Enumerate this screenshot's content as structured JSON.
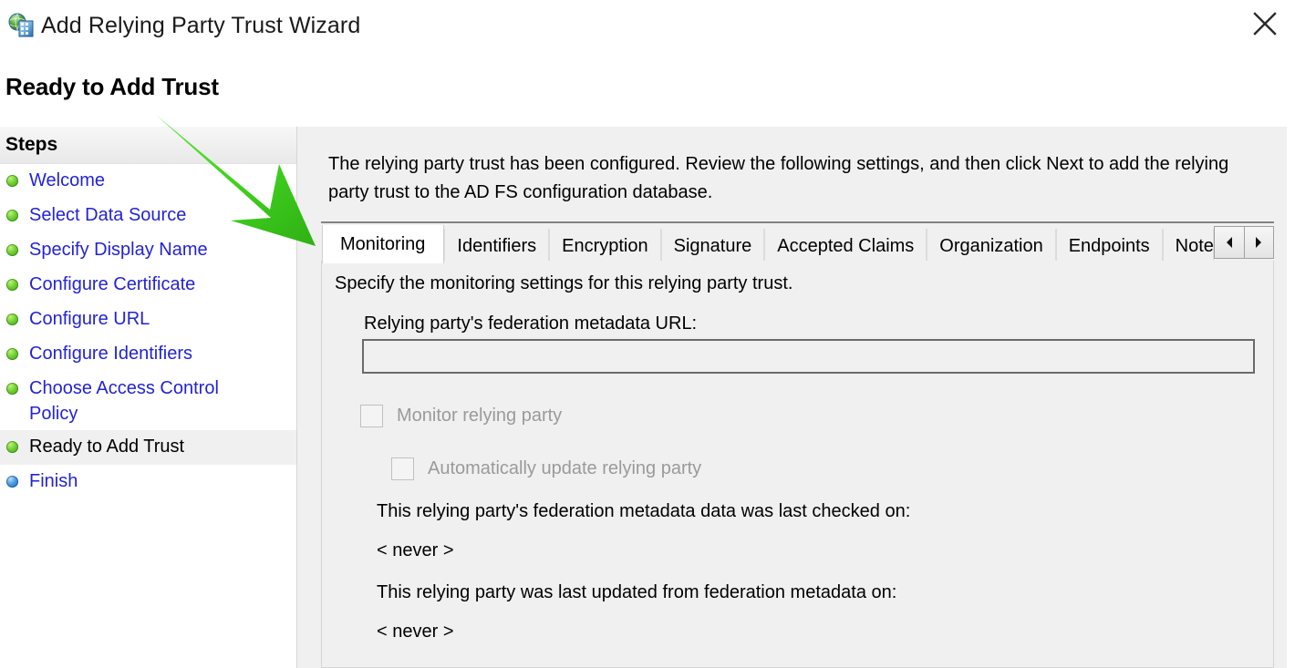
{
  "window": {
    "title": "Add Relying Party Trust Wizard",
    "icon": "globe-server-icon",
    "close_label": "close-icon"
  },
  "page": {
    "heading": "Ready to Add Trust",
    "intro": "The relying party trust has been configured. Review the following settings, and then click Next to add the relying party trust to the AD FS configuration database."
  },
  "sidebar": {
    "header": "Steps",
    "items": [
      {
        "label": "Welcome",
        "state": "done",
        "bullet": "green"
      },
      {
        "label": "Select Data Source",
        "state": "done",
        "bullet": "green"
      },
      {
        "label": "Specify Display Name",
        "state": "done",
        "bullet": "green"
      },
      {
        "label": "Configure Certificate",
        "state": "done",
        "bullet": "green"
      },
      {
        "label": "Configure URL",
        "state": "done",
        "bullet": "green"
      },
      {
        "label": "Configure Identifiers",
        "state": "done",
        "bullet": "green"
      },
      {
        "label": "Choose Access Control Policy",
        "state": "done",
        "bullet": "green"
      },
      {
        "label": "Ready to Add Trust",
        "state": "current",
        "bullet": "green"
      },
      {
        "label": "Finish",
        "state": "pending",
        "bullet": "blue"
      }
    ]
  },
  "tabs": {
    "items": [
      {
        "label": "Monitoring",
        "selected": true
      },
      {
        "label": "Identifiers",
        "selected": false
      },
      {
        "label": "Encryption",
        "selected": false
      },
      {
        "label": "Signature",
        "selected": false
      },
      {
        "label": "Accepted Claims",
        "selected": false
      },
      {
        "label": "Organization",
        "selected": false
      },
      {
        "label": "Endpoints",
        "selected": false
      },
      {
        "label": "Note",
        "selected": false,
        "truncated": true
      }
    ],
    "scroll_left": "scroll-left-icon",
    "scroll_right": "scroll-right-icon"
  },
  "monitoring_panel": {
    "description": "Specify the monitoring settings for this relying party trust.",
    "url_label": "Relying party's federation metadata URL:",
    "url_value": "",
    "url_placeholder": "",
    "monitor_checkbox": {
      "label": "Monitor relying party",
      "checked": false,
      "disabled": true
    },
    "autoupdate_checkbox": {
      "label": "Automatically update relying party",
      "checked": false,
      "disabled": true
    },
    "last_checked_label": "This relying party's federation metadata data was last checked on:",
    "last_checked_value": "< never >",
    "last_updated_label": "This relying party was last updated from federation metadata on:",
    "last_updated_value": "< never >"
  },
  "annotation": {
    "arrow": "green-arrow-annotation",
    "color": "#44d62c"
  }
}
